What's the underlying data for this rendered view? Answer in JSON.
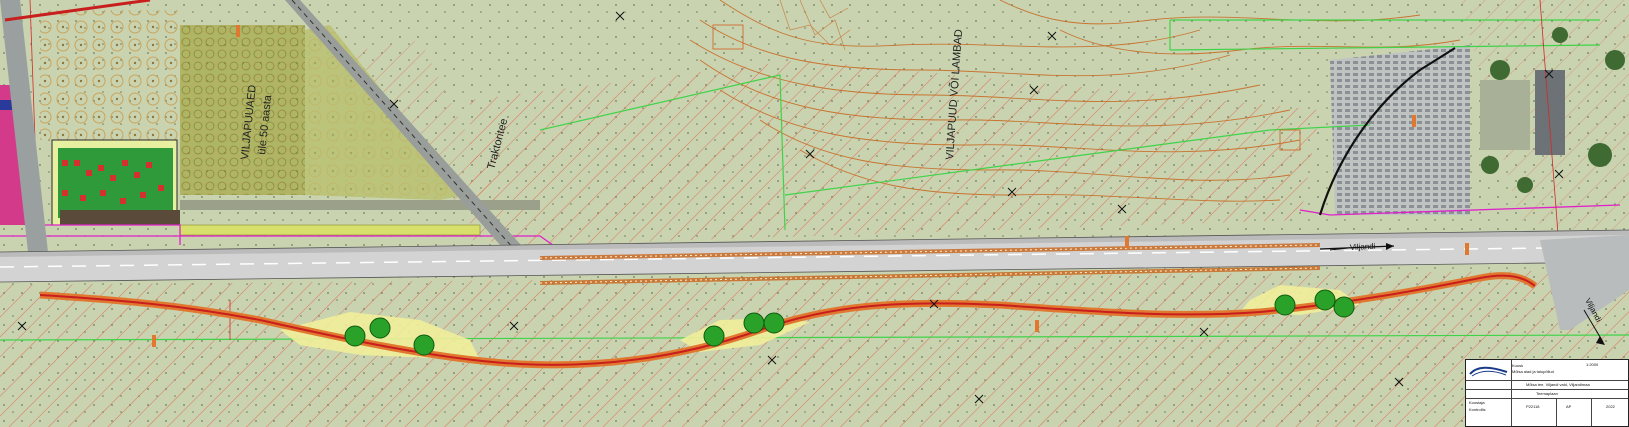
{
  "labels": {
    "viljapuud_vanad": "VILJAPUUAED",
    "viljapuud_age": "üle 50 aasta",
    "traktoritee": "Traktoritee",
    "viljapuud_lambad": "VILJAPUUD VÕI LAMBAD",
    "viljandi_road": "Viljandi",
    "viljandi_arrow_right": "Viljandi"
  },
  "title_block": {
    "header_line1": "Kuusk",
    "header_line2": "Mõisa aiad ja talupõllud",
    "row_project": "Mõisa tee, Viljandi vald, Viljandimaa",
    "row_drawing": "Teemaplaan",
    "row_number": "P22118",
    "row_scale": "1:2000",
    "row_date": "2022",
    "row_sheet": "AP",
    "row_author": "Koostaja",
    "row_checked": "Kontrollis"
  },
  "colors": {
    "field": "#c9d3b0",
    "hatch_red": "#e0604a",
    "road": "#cfcfcf",
    "contour": "#c86a23",
    "green_line": "#3fd34a",
    "magenta_line": "#e020c8",
    "pipeline_orange": "#e07830",
    "pipeline_red": "#c81e1e",
    "yellow_zone": "#f0ee9a",
    "tree_green": "#2aa22a"
  }
}
